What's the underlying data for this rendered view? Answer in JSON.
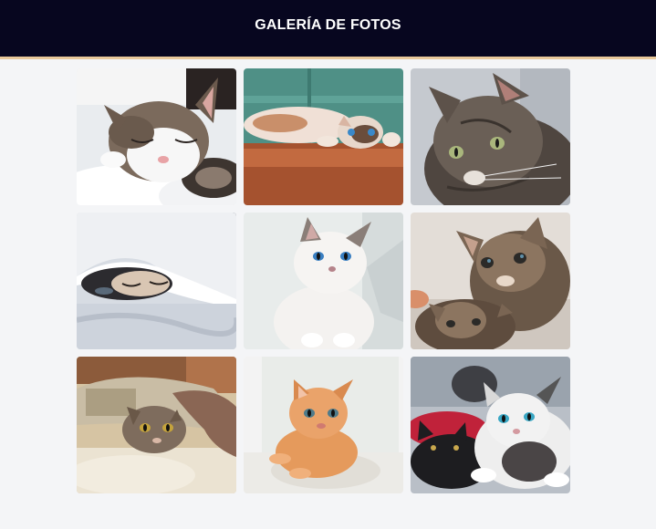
{
  "header": {
    "title": "GALERÍA DE FOTOS"
  },
  "colors": {
    "header_bg": "#07061f",
    "header_border": "#e8c89a",
    "page_bg": "#f4f5f7"
  },
  "gallery": {
    "photos": [
      {
        "name": "sleeping-tabby-white-cat-photo"
      },
      {
        "name": "cat-lying-on-floor-photo"
      },
      {
        "name": "tabby-cat-portrait-photo"
      },
      {
        "name": "cat-under-blanket-photo"
      },
      {
        "name": "white-kitten-photo"
      },
      {
        "name": "tabby-kittens-photo"
      },
      {
        "name": "cat-under-pillow-photo"
      },
      {
        "name": "orange-kitten-photo"
      },
      {
        "name": "black-and-white-kittens-photo"
      }
    ]
  }
}
